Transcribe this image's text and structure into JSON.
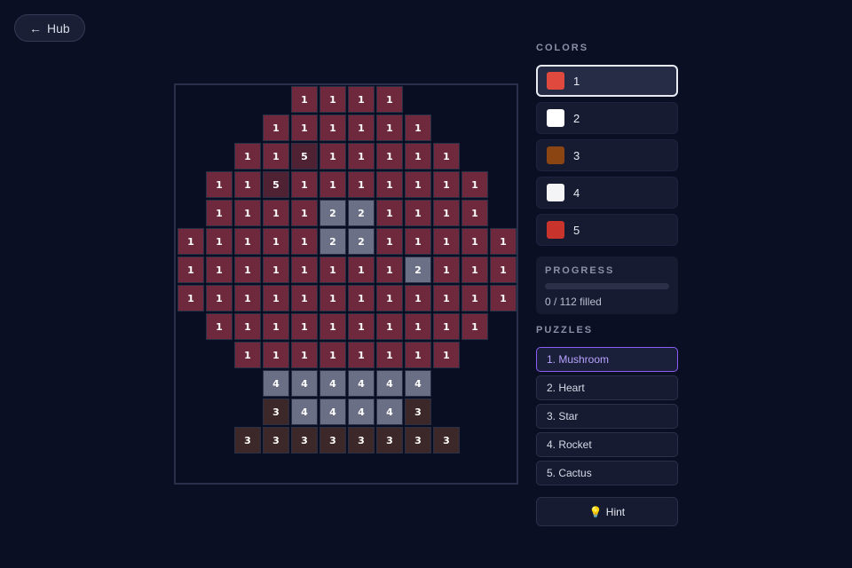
{
  "nav": {
    "hub_icon": "←",
    "hub_label": "Hub"
  },
  "board": {
    "cols": 12,
    "rows": [
      "....1111....",
      "...111111...",
      "..11511111..",
      ".1151111111.",
      ".1111221111.",
      "111112211111",
      "111111112111",
      "111111111111",
      ".1111111111.",
      "..11111111..",
      "...444444...",
      "...344443...",
      "..33333333.."
    ]
  },
  "colors": {
    "title": "COLORS",
    "selected": "1",
    "items": [
      {
        "label": "1",
        "color": "#e04a3e"
      },
      {
        "label": "2",
        "color": "#ffffff"
      },
      {
        "label": "3",
        "color": "#8b4513"
      },
      {
        "label": "4",
        "color": "#f4f4f6"
      },
      {
        "label": "5",
        "color": "#c8342b"
      }
    ],
    "cell_colors": {
      "1": "#6e2a3c",
      "2": "#6b7086",
      "3": "#3d2829",
      "4": "#6a6f85",
      "5": "#4e2232"
    }
  },
  "progress": {
    "title": "PROGRESS",
    "filled": 0,
    "total": 112,
    "text": "0 / 112 filled",
    "fraction": 0
  },
  "puzzles": {
    "title": "PUZZLES",
    "active": "1. Mushroom",
    "items": [
      "1. Mushroom",
      "2. Heart",
      "3. Star",
      "4. Rocket",
      "5. Cactus"
    ]
  },
  "hint": {
    "icon": "💡",
    "label": "Hint"
  }
}
